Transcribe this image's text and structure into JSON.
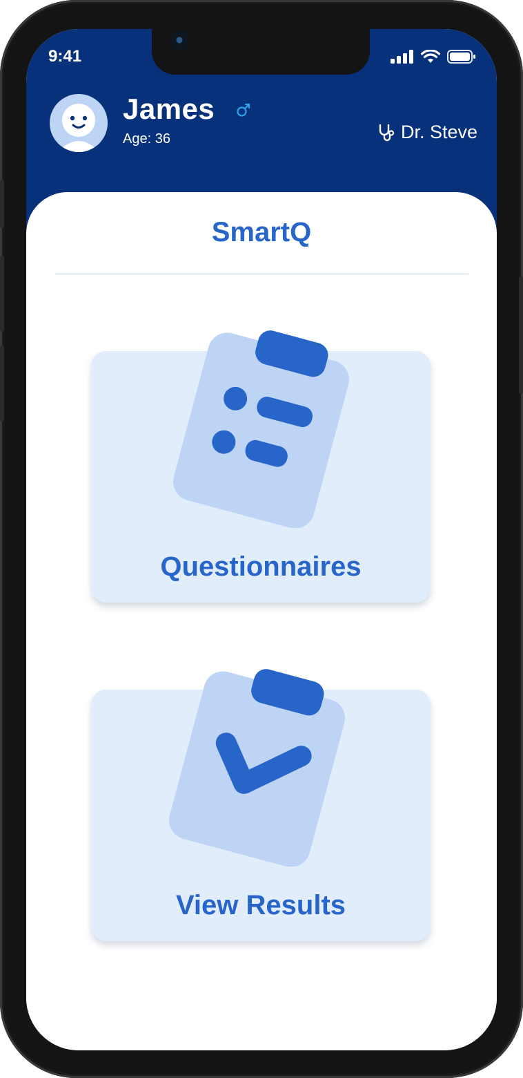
{
  "status_bar": {
    "time": "9:41"
  },
  "header": {
    "patient_name": "James",
    "patient_age": "Age: 36",
    "doctor_name": "Dr. Steve",
    "gender_symbol": "♂"
  },
  "app": {
    "title": "SmartQ"
  },
  "menu": [
    {
      "label": "Questionnaires",
      "icon": "clipboard-list-icon"
    },
    {
      "label": "View Results",
      "icon": "clipboard-check-icon"
    }
  ],
  "colors": {
    "header_bg": "#07317a",
    "accent": "#2766c8",
    "tile_bg": "#e2edfb",
    "illustration_light": "#bdd4f5"
  }
}
